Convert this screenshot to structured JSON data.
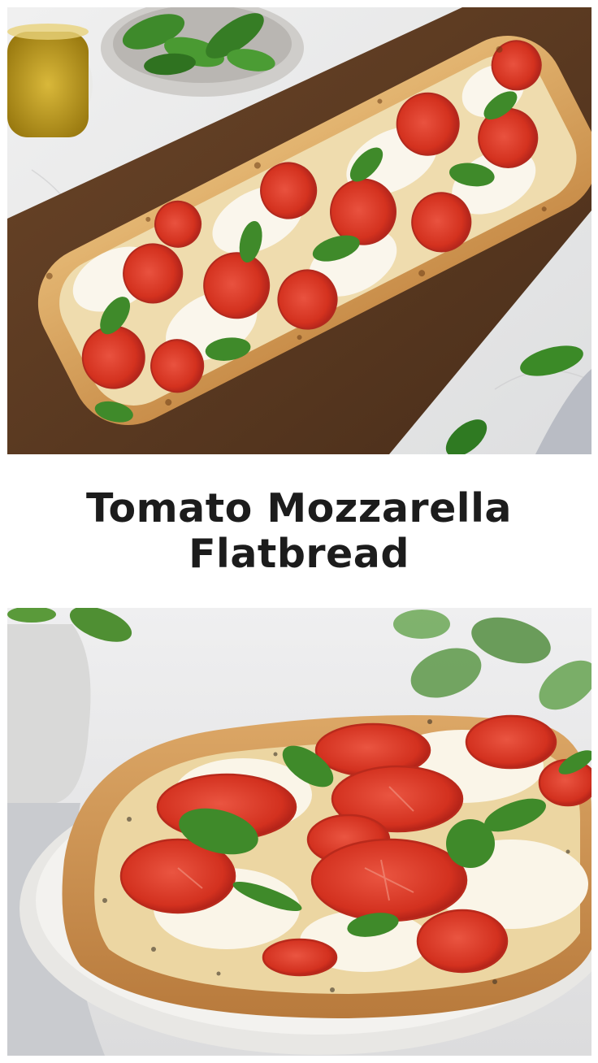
{
  "title": {
    "line1": "Tomato Mozzarella",
    "line2": "Flatbread"
  },
  "colors": {
    "background": "#ffffff",
    "title_text": "#1c1c1c",
    "marble": "#e9e9ea",
    "board": "#5a3a22",
    "crust": "#dba765",
    "tomato": "#d8352a",
    "mozzarella": "#f7f3e8",
    "basil": "#3f8a2a",
    "plate": "#f1f0ee"
  }
}
